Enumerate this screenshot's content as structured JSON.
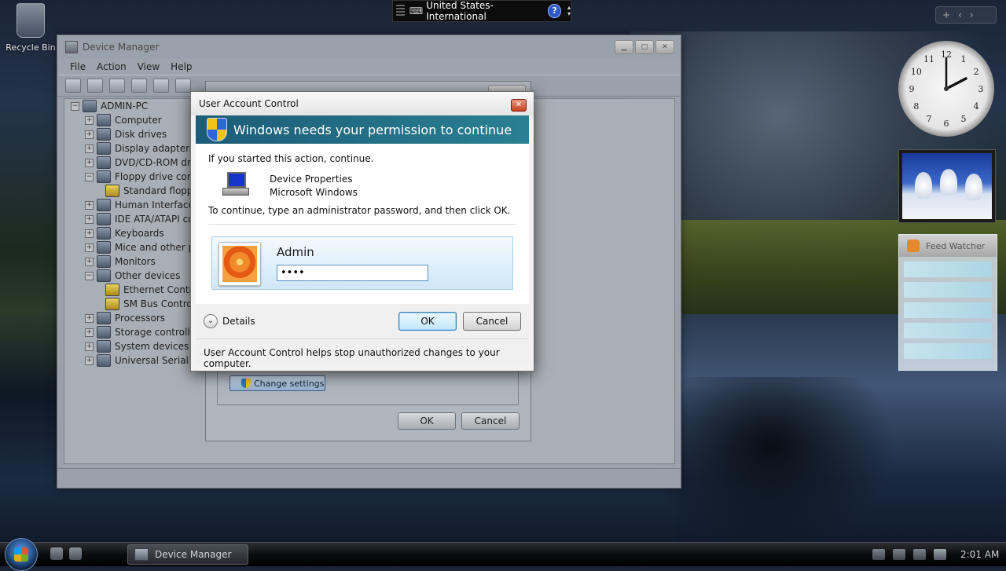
{
  "desktop": {
    "recycle_bin_label": "Recycle Bin"
  },
  "language_bar": {
    "language": "United States-International",
    "help_glyph": "?"
  },
  "sidebar": {
    "feed_watcher_title": "Feed Watcher",
    "clock_numbers": [
      "12",
      "1",
      "2",
      "3",
      "4",
      "5",
      "6",
      "7",
      "8",
      "9",
      "10",
      "11"
    ]
  },
  "device_manager": {
    "title": "Device Manager",
    "menu": [
      "File",
      "Action",
      "View",
      "Help"
    ],
    "tree": {
      "root": "ADMIN-PC",
      "items": [
        "Computer",
        "Disk drives",
        "Display adapters",
        "DVD/CD-ROM driv",
        "Floppy drive contr",
        "Standard floppy",
        "Human Interface D",
        "IDE ATA/ATAPI co",
        "Keyboards",
        "Mice and other po",
        "Monitors",
        "Other devices",
        "Ethernet Contro",
        "SM Bus Contro",
        "Processors",
        "Storage controllers",
        "System devices",
        "Universal Serial Bus"
      ]
    }
  },
  "device_properties": {
    "change_settings_label": "Change settings",
    "ok_label": "OK",
    "cancel_label": "Cancel"
  },
  "uac": {
    "title": "User Account Control",
    "banner": "Windows needs your permission to continue",
    "started_text": "If you started this action, continue.",
    "program_name": "Device Properties",
    "publisher": "Microsoft Windows",
    "instruction": "To continue, type an administrator password, and then click OK.",
    "username": "Admin",
    "password_value": "••••",
    "details_label": "Details",
    "ok_label": "OK",
    "cancel_label": "Cancel",
    "help_text": "User Account Control helps stop unauthorized changes to your computer."
  },
  "taskbar": {
    "task_label": "Device Manager",
    "time": "2:01 AM"
  }
}
